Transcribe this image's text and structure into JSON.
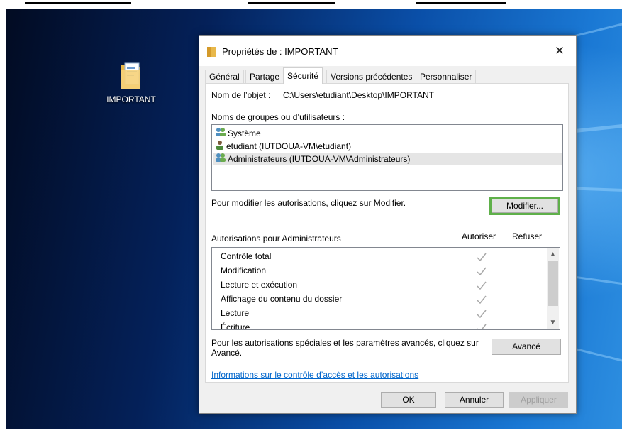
{
  "desktop": {
    "icon_label": "IMPORTANT"
  },
  "dialog": {
    "title": "Propriétés de : IMPORTANT",
    "tabs": [
      {
        "label": "Général"
      },
      {
        "label": "Partage"
      },
      {
        "label": "Sécurité"
      },
      {
        "label": "Versions précédentes"
      },
      {
        "label": "Personnaliser"
      }
    ],
    "active_tab": "Sécurité",
    "object_name_label": "Nom de l’objet :",
    "object_name_value": "C:\\Users\\etudiant\\Desktop\\IMPORTANT",
    "groups_label": "Noms de groupes ou d’utilisateurs :",
    "groups": [
      {
        "name": "Système",
        "icon": "group-users-icon"
      },
      {
        "name": "etudiant (IUTDOUA-VM\\etudiant)",
        "icon": "user-icon"
      },
      {
        "name": "Administrateurs (IUTDOUA-VM\\Administrateurs)",
        "icon": "group-users-icon",
        "selected": true
      }
    ],
    "modify_hint": "Pour modifier les autorisations, cliquez sur Modifier.",
    "modify_button": "Modifier...",
    "permissions_label": "Autorisations pour Administrateurs",
    "col_allow": "Autoriser",
    "col_deny": "Refuser",
    "permissions": [
      {
        "name": "Contrôle total",
        "allow": true,
        "deny": false
      },
      {
        "name": "Modification",
        "allow": true,
        "deny": false
      },
      {
        "name": "Lecture et exécution",
        "allow": true,
        "deny": false
      },
      {
        "name": "Affichage du contenu du dossier",
        "allow": true,
        "deny": false
      },
      {
        "name": "Lecture",
        "allow": true,
        "deny": false
      },
      {
        "name": "Écriture",
        "allow": true,
        "deny": false
      }
    ],
    "advanced_hint_line1": "Pour les autorisations spéciales et les paramètres avancés, cliquez sur",
    "advanced_hint_line2": "Avancé.",
    "advanced_button": "Avancé",
    "info_link": "Informations sur le contrôle d’accès et les autorisations",
    "ok_button": "OK",
    "cancel_button": "Annuler",
    "apply_button": "Appliquer"
  },
  "colors": {
    "focus_ring": "#5fb04a",
    "link": "#0066cc",
    "selection": "#e5e5e5"
  }
}
